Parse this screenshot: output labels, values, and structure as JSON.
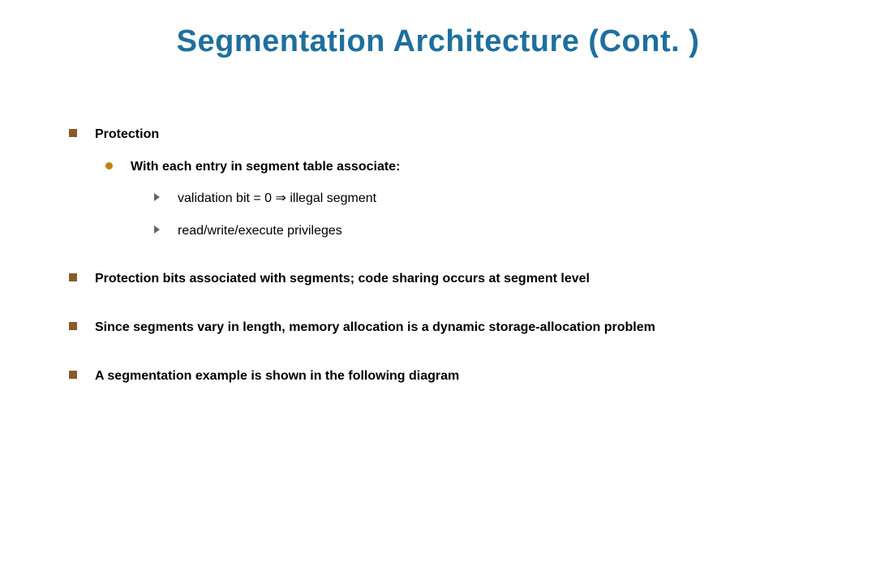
{
  "title": "Segmentation Architecture (Cont. )",
  "bullets": {
    "l1_a": "Protection",
    "l2_a": "With each entry in segment table associate:",
    "l3_a": "validation bit = 0 ⇒ illegal segment",
    "l3_b": "read/write/execute privileges",
    "l1_b": "Protection bits associated with segments; code sharing occurs at segment level",
    "l1_c": "Since segments vary in length, memory allocation is a dynamic storage-allocation problem",
    "l1_d": "A segmentation example is shown in the following diagram"
  }
}
